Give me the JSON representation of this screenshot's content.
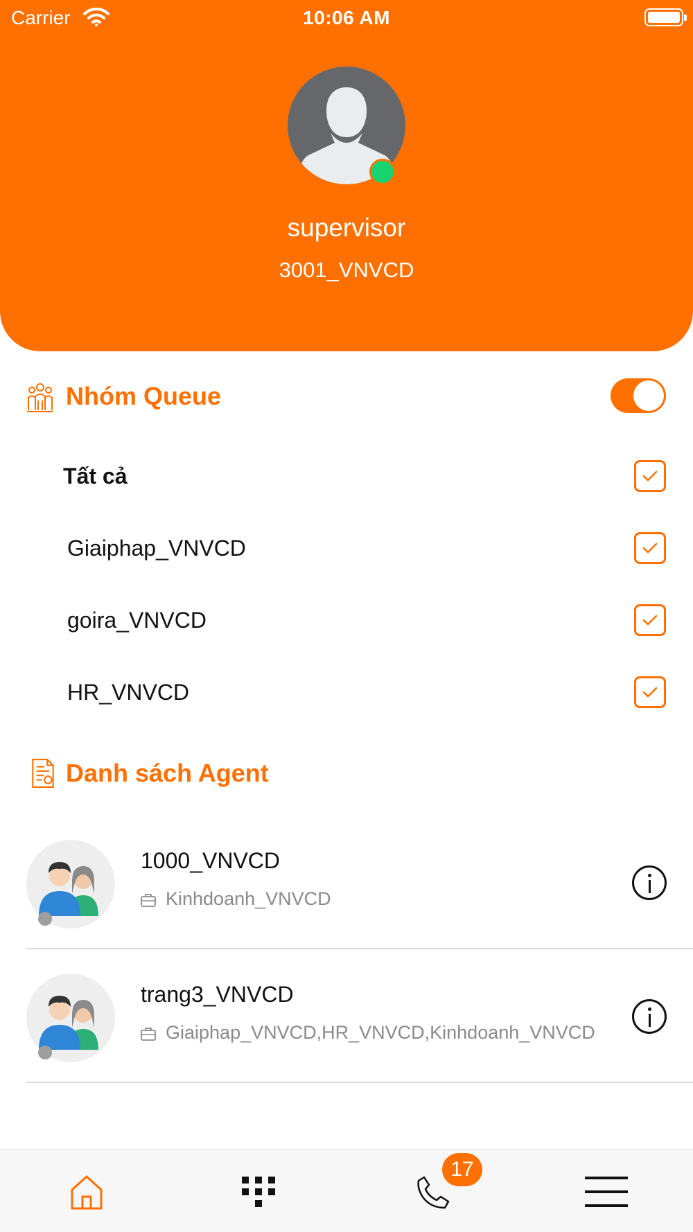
{
  "status_bar": {
    "carrier": "Carrier",
    "time": "10:06 AM"
  },
  "profile": {
    "name": "supervisor",
    "extension": "3001_VNVCD",
    "online": true
  },
  "queue_section": {
    "title": "Nhóm Queue",
    "icon": "queue-group-icon",
    "toggle_on": true,
    "items": [
      {
        "label": "Tất cả",
        "checked": true
      },
      {
        "label": "Giaiphap_VNVCD",
        "checked": true
      },
      {
        "label": "goira_VNVCD",
        "checked": true
      },
      {
        "label": "HR_VNVCD",
        "checked": true
      }
    ]
  },
  "agent_section": {
    "title": "Danh sách Agent",
    "icon": "document-list-icon",
    "agents": [
      {
        "name": "1000_VNVCD",
        "groups": "Kinhdoanh_VNVCD",
        "status": "offline"
      },
      {
        "name": "trang3_VNVCD",
        "groups": "Giaiphap_VNVCD,HR_VNVCD,Kinhdoanh_VNVCD",
        "status": "offline"
      }
    ]
  },
  "tabbar": {
    "tabs": [
      {
        "icon": "home-icon",
        "active": true
      },
      {
        "icon": "dialpad-icon",
        "active": false
      },
      {
        "icon": "phone-icon",
        "active": false,
        "badge": "17"
      },
      {
        "icon": "menu-icon",
        "active": false
      }
    ]
  },
  "colors": {
    "accent": "#FF7000",
    "online": "#18D36D",
    "offline": "#9E9E9E"
  }
}
